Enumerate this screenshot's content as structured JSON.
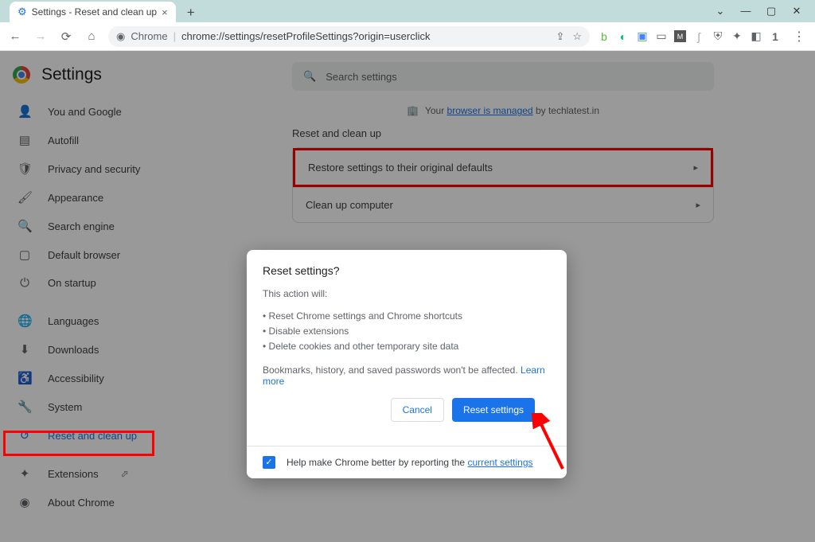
{
  "window": {
    "tab_title": "Settings - Reset and clean up"
  },
  "toolbar": {
    "chrome_label": "Chrome",
    "url": "chrome://settings/resetProfileSettings?origin=userclick"
  },
  "settings": {
    "title": "Settings",
    "search_placeholder": "Search settings",
    "banner_prefix": "Your",
    "banner_link": "browser is managed",
    "banner_suffix": "by techlatest.in",
    "section": "Reset and clean up",
    "card": {
      "row1": "Restore settings to their original defaults",
      "row2": "Clean up computer"
    }
  },
  "sidebar": {
    "items": [
      {
        "label": "You and Google"
      },
      {
        "label": "Autofill"
      },
      {
        "label": "Privacy and security"
      },
      {
        "label": "Appearance"
      },
      {
        "label": "Search engine"
      },
      {
        "label": "Default browser"
      },
      {
        "label": "On startup"
      },
      {
        "label": "Languages"
      },
      {
        "label": "Downloads"
      },
      {
        "label": "Accessibility"
      },
      {
        "label": "System"
      },
      {
        "label": "Reset and clean up"
      },
      {
        "label": "Extensions"
      },
      {
        "label": "About Chrome"
      }
    ]
  },
  "dialog": {
    "title": "Reset settings?",
    "intro": "This action will:",
    "bullet1": "Reset Chrome settings and Chrome shortcuts",
    "bullet2": "Disable extensions",
    "bullet3": "Delete cookies and other temporary site data",
    "note_prefix": "Bookmarks, history, and saved passwords won't be affected.",
    "learn_more": "Learn more",
    "cancel": "Cancel",
    "confirm": "Reset settings",
    "footer_prefix": "Help make Chrome better by reporting the",
    "footer_link": "current settings"
  }
}
